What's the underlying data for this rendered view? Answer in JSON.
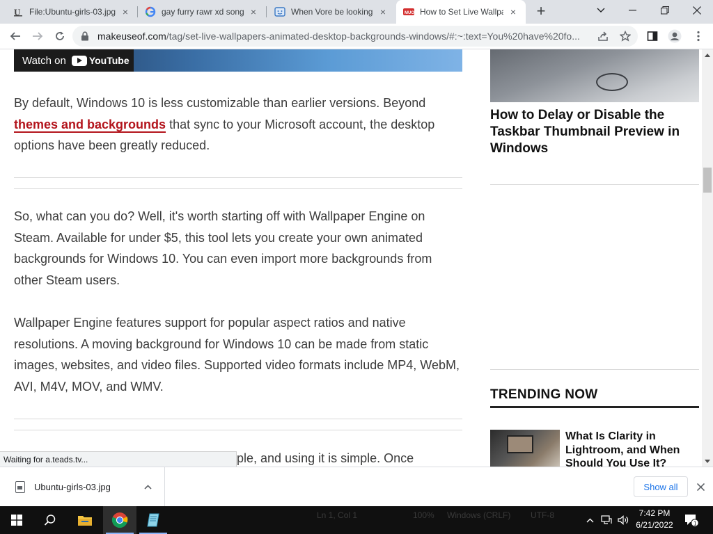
{
  "tabs": [
    {
      "title": "File:Ubuntu-girls-03.jpg",
      "close": "×"
    },
    {
      "title": "gay furry rawr xd song",
      "close": "×"
    },
    {
      "title": "When Vore be looking",
      "close": "×"
    },
    {
      "title": "How to Set Live Wallpa",
      "close": "×"
    }
  ],
  "new_tab": "+",
  "url": {
    "host": "makeuseof.com",
    "path": "/tag/set-live-wallpapers-animated-desktop-backgrounds-windows/#:~:text=You%20have%20fo..."
  },
  "article": {
    "video_watch_on": "Watch on",
    "video_brand": "YouTube",
    "p1_before": "By default, Windows 10 is less customizable than earlier versions. Beyond ",
    "p1_link": "themes and backgrounds",
    "p1_after": " that sync to your Microsoft account, the desktop options have been greatly reduced.",
    "p2": "So, what can you do? Well, it's worth starting off with Wallpaper Engine on Steam. Available for under $5, this tool lets you create your own animated backgrounds for Windows 10. You can even import more backgrounds from other Steam users.",
    "p3": "Wallpaper Engine features support for popular aspect ratios and native resolutions. A moving background for Windows 10 can be made from static images, websites, and video files. Supported video formats include MP4, WebM, AVI, M4V, MOV, and WMV.",
    "p4_partial": "ple, and using it is simple. Once"
  },
  "sidebar": {
    "related_title": "How to Delay or Disable the Taskbar Thumbnail Preview in Windows",
    "trending_heading": "TRENDING NOW",
    "trend_item_title": "What Is Clarity in Lightroom, and When Should You Use It?"
  },
  "status_text": "Waiting for a.teads.tv...",
  "downloads": {
    "file_name": "Ubuntu-girls-03.jpg",
    "show_all": "Show all",
    "close": "×"
  },
  "taskbar": {
    "ghost_text": [
      "Ln 1, Col 1",
      "100%",
      "Windows (CRLF)",
      "UTF-8"
    ],
    "time": "7:42 PM",
    "date": "6/21/2022",
    "notification_count": "1"
  },
  "colors": {
    "link": "#b3141c",
    "tabstrip": "#dee1e6",
    "taskbar": "#101010",
    "show_all": "#1a73e8"
  }
}
